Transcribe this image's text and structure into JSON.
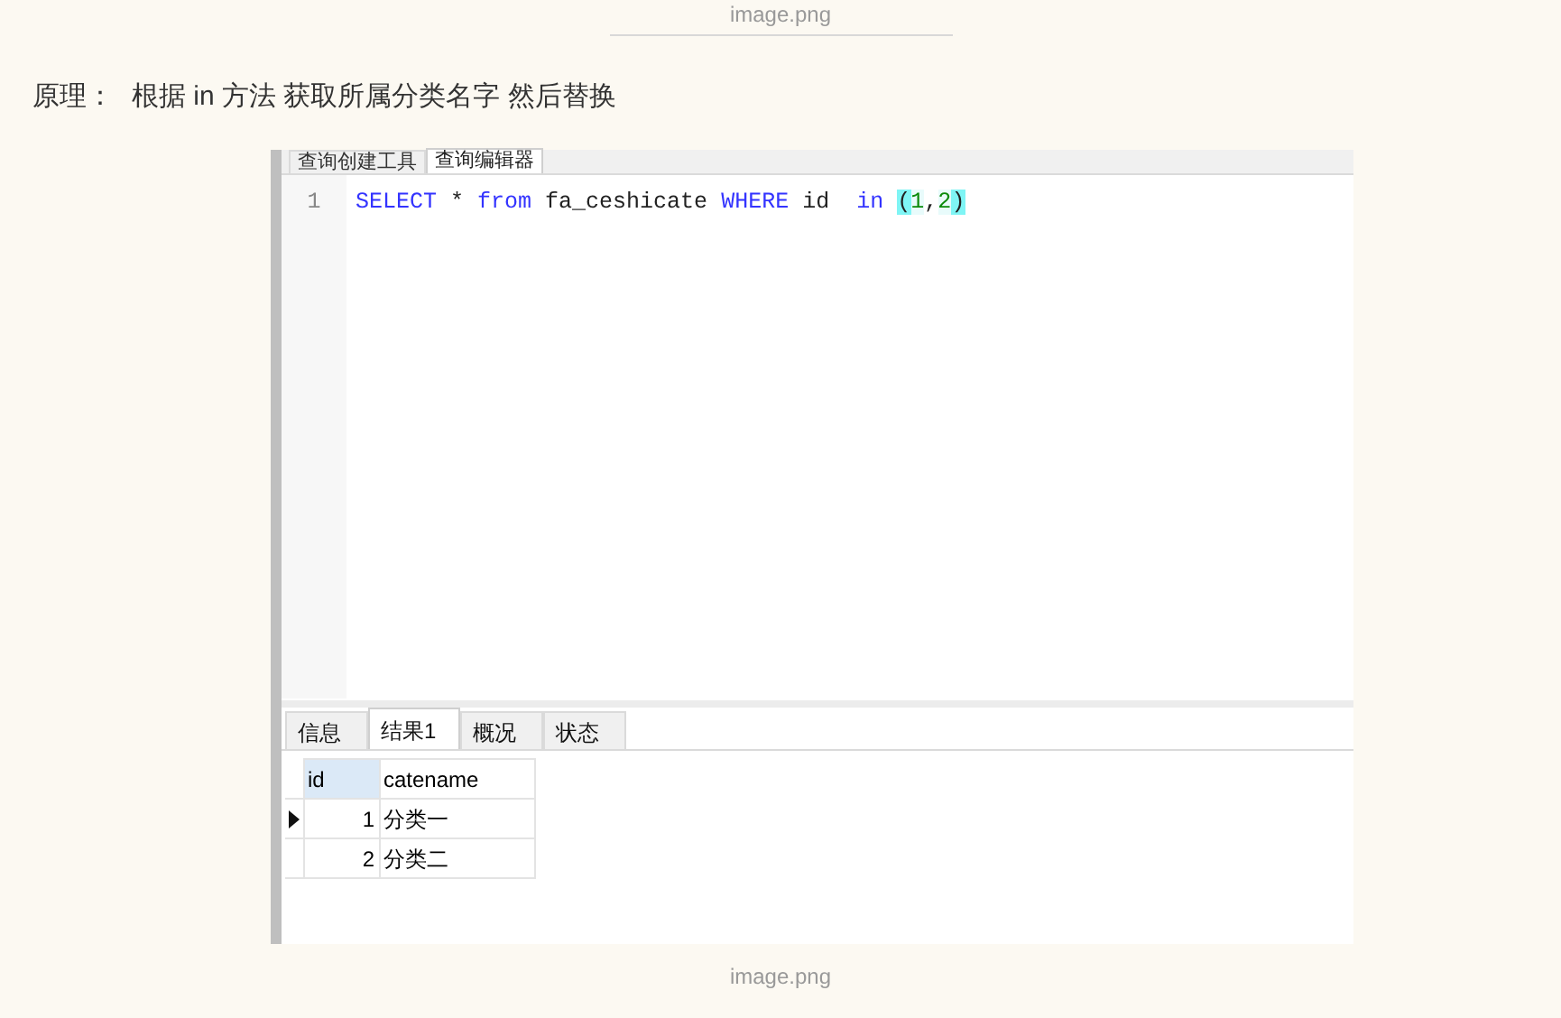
{
  "top_caption": "image.png",
  "paragraph": {
    "label": "原理：",
    "text": "根据 in 方法 获取所属分类名字 然后替换"
  },
  "screenshot": {
    "editor_tabs": [
      {
        "label": "查询创建工具",
        "selected": false
      },
      {
        "label": "查询编辑器",
        "selected": true
      }
    ],
    "editor_lines": [
      {
        "number": "1",
        "tokens": [
          {
            "text": "SELECT",
            "kind": "keyword"
          },
          {
            "text": " * ",
            "kind": "plain"
          },
          {
            "text": "from",
            "kind": "keyword"
          },
          {
            "text": " fa_ceshicate ",
            "kind": "plain"
          },
          {
            "text": "WHERE",
            "kind": "keyword"
          },
          {
            "text": " id  ",
            "kind": "plain"
          },
          {
            "text": "in ",
            "kind": "keyword"
          },
          {
            "text": "(",
            "kind": "paren"
          },
          {
            "text": "1",
            "kind": "number"
          },
          {
            "text": ",",
            "kind": "plain"
          },
          {
            "text": "2",
            "kind": "number"
          },
          {
            "text": ")",
            "kind": "paren"
          }
        ]
      }
    ],
    "result_tabs": [
      {
        "label": "信息",
        "selected": false
      },
      {
        "label": "结果1",
        "selected": true
      },
      {
        "label": "概况",
        "selected": false
      },
      {
        "label": "状态",
        "selected": false
      }
    ],
    "table": {
      "columns": [
        "id",
        "catename"
      ],
      "rows": [
        {
          "cells": [
            "1",
            "分类一"
          ],
          "selected": true
        },
        {
          "cells": [
            "2",
            "分类二"
          ],
          "selected": false
        }
      ]
    }
  },
  "bottom_caption": "image.png"
}
